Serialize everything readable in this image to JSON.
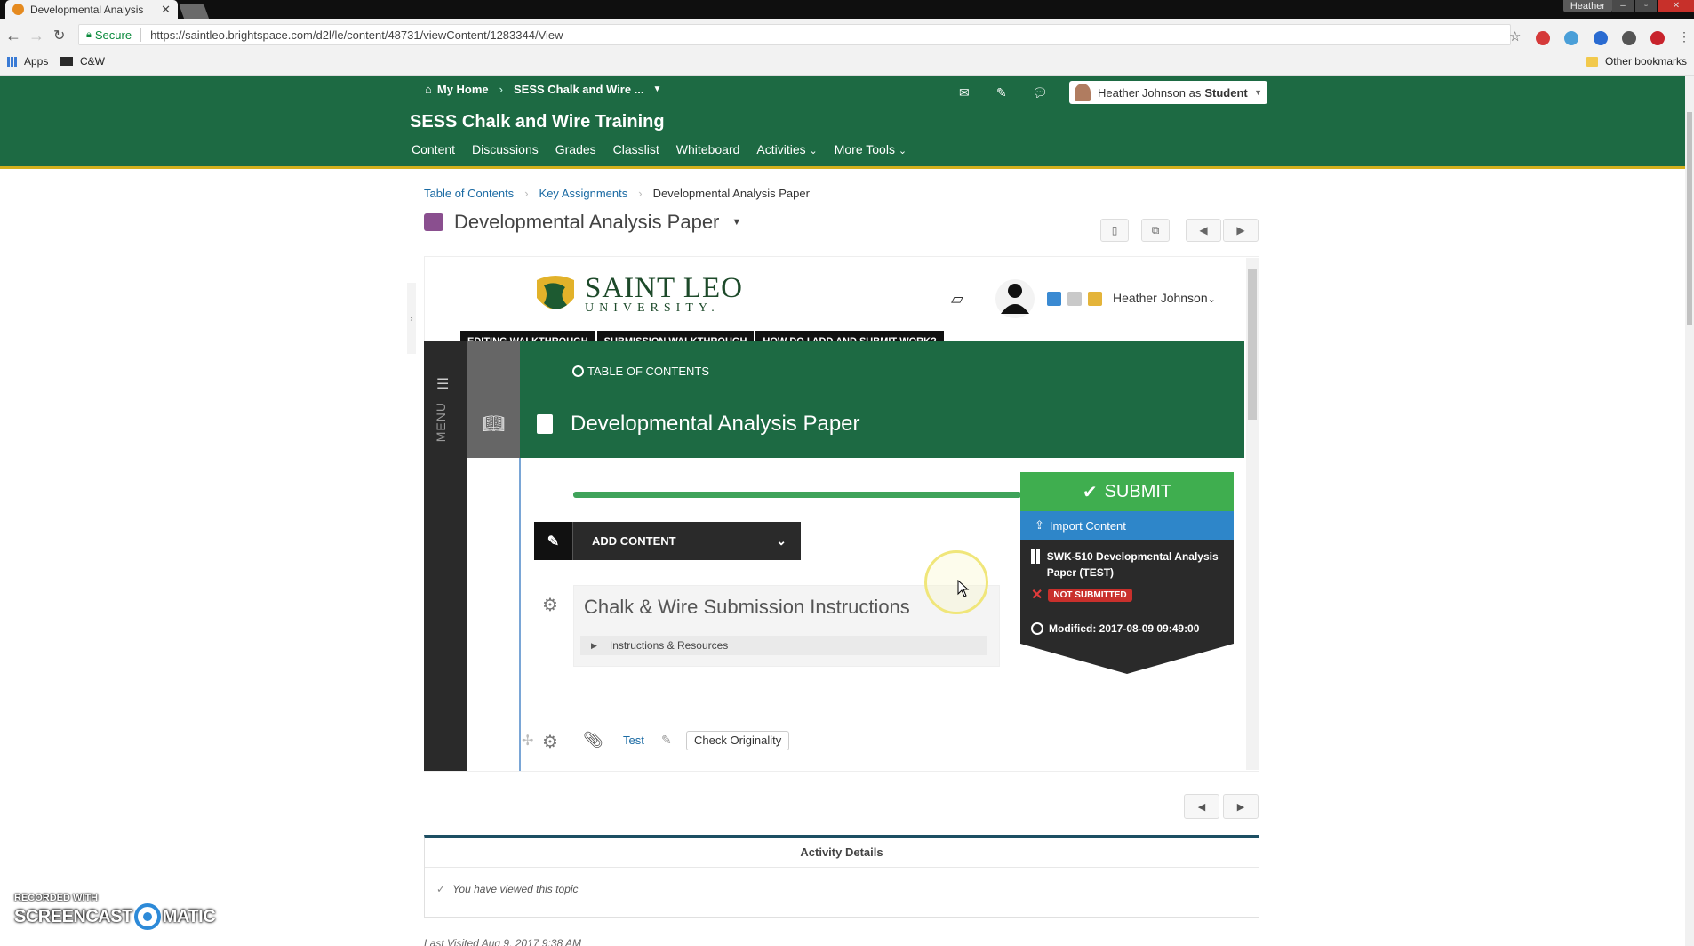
{
  "browser": {
    "tab_title": "Developmental Analysis",
    "window_user": "Heather",
    "secure_label": "Secure",
    "url": "https://saintleo.brightspace.com/d2l/le/content/48731/viewContent/1283344/View",
    "bookmarks": {
      "apps": "Apps",
      "cw": "C&W",
      "other": "Other bookmarks"
    }
  },
  "header": {
    "my_home": "My Home",
    "course_short": "SESS Chalk and Wire ...",
    "user_name": "Heather Johnson as",
    "user_role": "Student",
    "course_title": "SESS Chalk and Wire Training",
    "nav": [
      "Content",
      "Discussions",
      "Grades",
      "Classlist",
      "Whiteboard",
      "Activities",
      "More Tools"
    ]
  },
  "breadcrumb": [
    "Table of Contents",
    "Key Assignments",
    "Developmental Analysis Paper"
  ],
  "topic_title": "Developmental Analysis Paper",
  "embedded": {
    "logo_line1": "SAINT LEO",
    "logo_line2": "UNIVERSITY.",
    "user": "Heather Johnson",
    "walkthroughs": [
      "EDITING WALKTHROUGH",
      "SUBMISSION WALKTHROUGH",
      "HOW DO I ADD AND SUBMIT WORK?"
    ],
    "menu_label": "MENU",
    "toc_link": "TABLE OF CONTENTS",
    "title": "Developmental Analysis Paper",
    "add_content": "ADD CONTENT",
    "instructions_title": "Chalk & Wire Submission Instructions",
    "instructions_sub": "Instructions & Resources",
    "test_link": "Test",
    "check_originality": "Check Originality",
    "submit": {
      "button": "SUBMIT",
      "import": "Import Content",
      "assignment": "SWK-510 Developmental Analysis Paper (TEST)",
      "status": "NOT SUBMITTED",
      "modified": "Modified: 2017-08-09 09:49:00"
    }
  },
  "activity": {
    "title": "Activity Details",
    "viewed": "You have viewed this topic",
    "last_visited": "Last Visited Aug 9, 2017 9:38 AM"
  },
  "watermark": {
    "top": "RECORDED WITH",
    "left": "SCREENCAST",
    "right": "MATIC"
  },
  "colors": {
    "brand_green": "#1d6a43",
    "accent_gold": "#d4b01e",
    "submit_green": "#3fae4f",
    "import_blue": "#2e86c9"
  }
}
